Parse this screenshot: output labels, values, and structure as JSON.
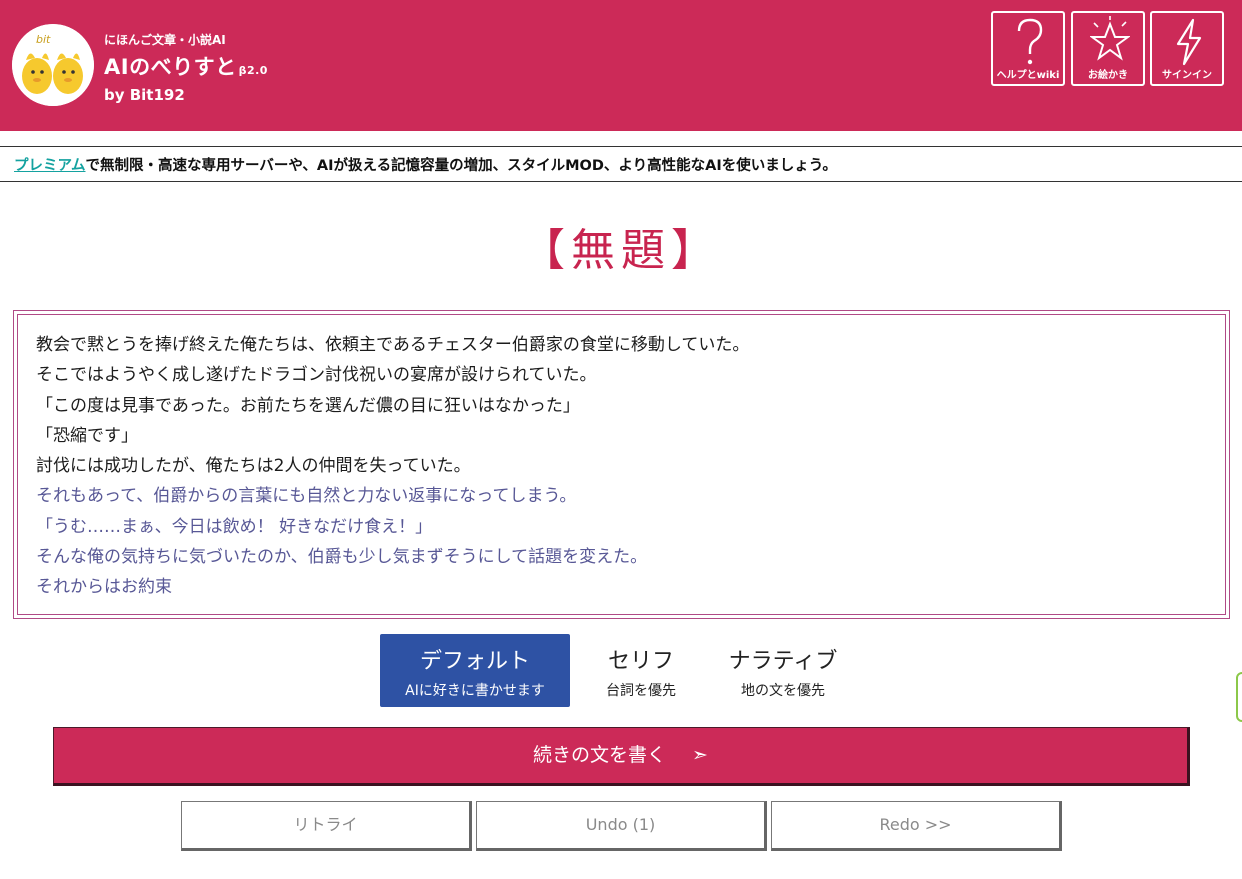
{
  "header": {
    "subtitle": "にほんご文章・小説AI",
    "title": "AIのべりすと",
    "version": "β2.0",
    "byline": "by Bit192",
    "logo_text": "bit",
    "buttons": [
      {
        "label": "ヘルプとwiki",
        "icon": "question-icon"
      },
      {
        "label": "お絵かき",
        "icon": "star-icon"
      },
      {
        "label": "サインイン",
        "icon": "lightning-icon"
      }
    ],
    "colors": {
      "brand": "#cc2a58",
      "accent_blue": "#2e52a4",
      "link_teal": "#14a2a0"
    }
  },
  "notice": {
    "link_text": "プレミアム",
    "text": "で無制限・高速な専用サーバーや、AIが扱える記憶容量の増加、スタイルMOD、より高性能なAIを使いましょう。"
  },
  "document": {
    "title": "【無題】",
    "lines": [
      {
        "text": "教会で黙とうを捧げ終えた俺たちは、依頼主であるチェスター伯爵家の食堂に移動していた。"
      },
      {
        "text": "そこではようやく成し遂げたドラゴン討伐祝いの宴席が設けられていた。"
      },
      {
        "text": "「この度は見事であった。お前たちを選んだ儂の目に狂いはなかった」"
      },
      {
        "text": "「恐縮です」"
      },
      {
        "text": "討伐には成功したが、俺たちは2人の仲間を失っていた。"
      },
      {
        "text": "それもあって、伯爵からの言葉にも自然と力ない返事になってしまう。"
      },
      {
        "text": "「うむ……まぁ、今日は飲め！ 好きなだけ食え！」"
      },
      {
        "text": "そんな俺の気持ちに気づいたのか、伯爵も少し気まずそうにして話題を変えた。"
      },
      {
        "text": "それからはお約束"
      }
    ]
  },
  "modes": [
    {
      "label": "デフォルト",
      "sub": "AIに好きに書かせます",
      "selected": true
    },
    {
      "label": "セリフ",
      "sub": "台詞を優先",
      "selected": false
    },
    {
      "label": "ナラティブ",
      "sub": "地の文を優先",
      "selected": false
    }
  ],
  "actions": {
    "continue_label": "続きの文を書く",
    "continue_arrow": "➣",
    "retry_label": "リトライ",
    "undo_label": "Undo (1)",
    "redo_label": "Redo >>"
  }
}
